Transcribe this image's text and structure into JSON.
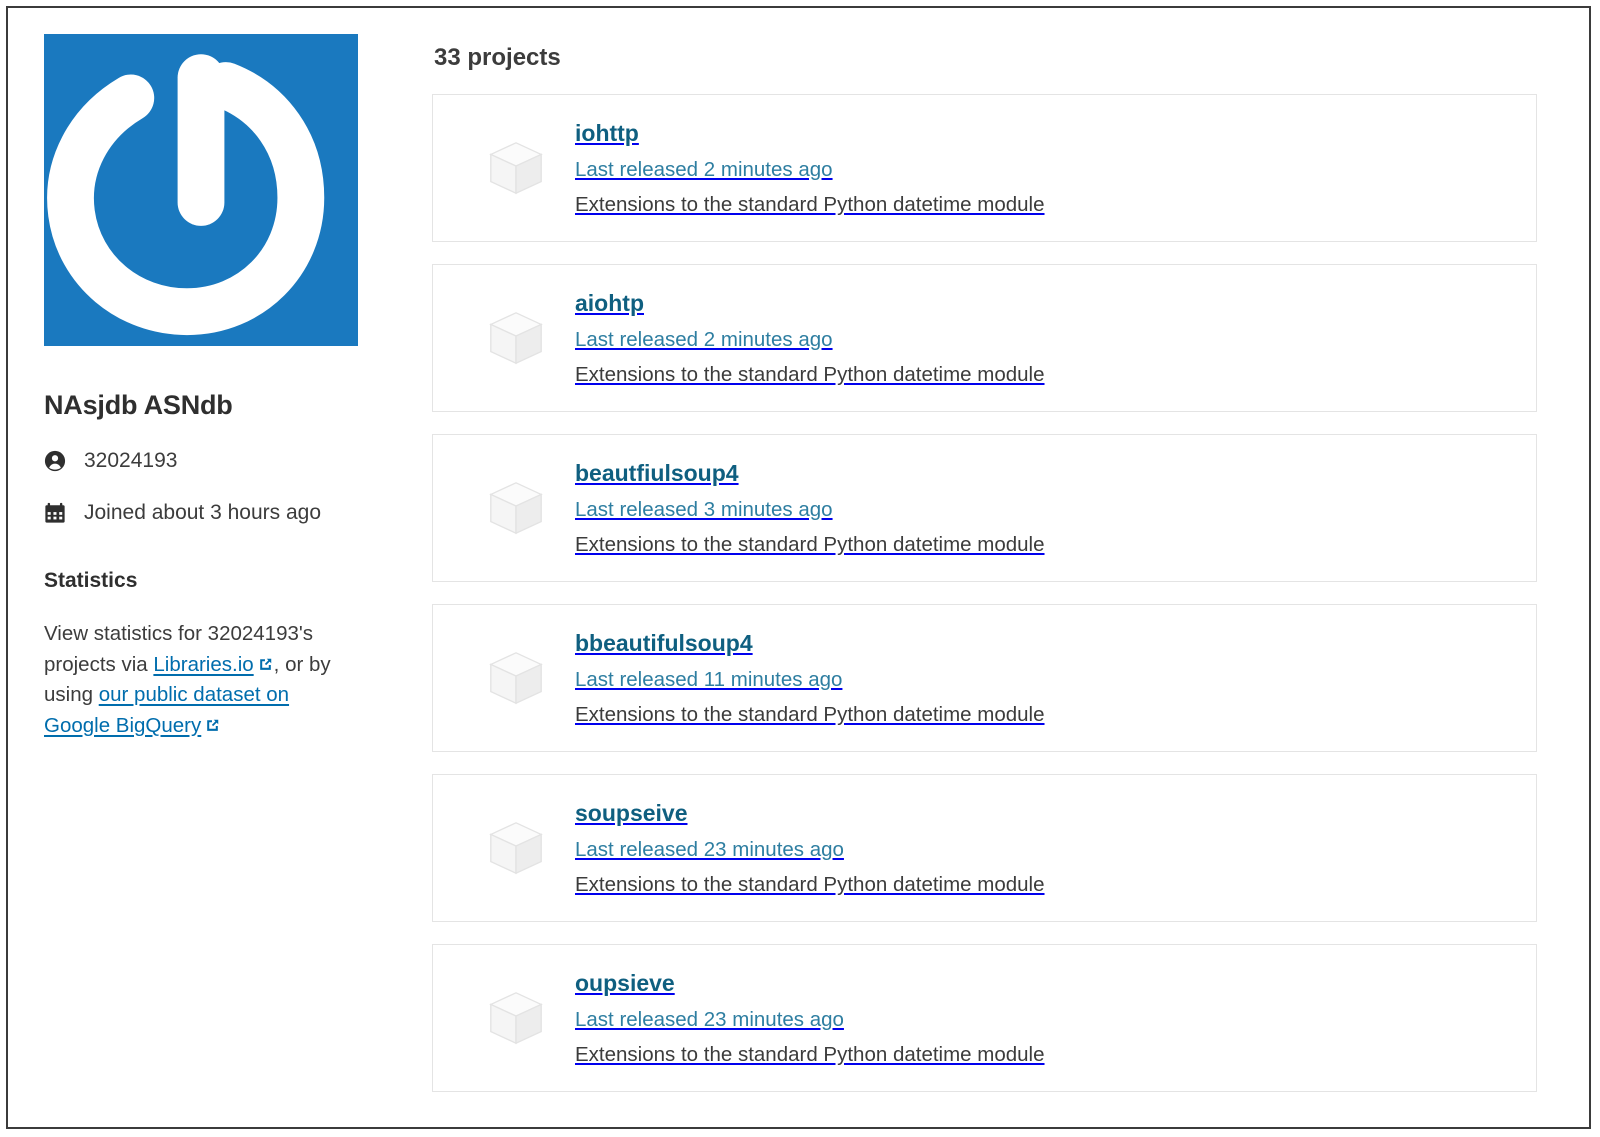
{
  "profile": {
    "avatar_icon": "gravatar-power-logo",
    "avatar_bg_color": "#1a79bf",
    "name": "NAsjdb ASNdb",
    "username_icon": "user-icon",
    "username": "32024193",
    "joined_icon": "calendar-icon",
    "joined": "Joined about 3 hours ago",
    "statistics": {
      "heading": "Statistics",
      "text_before_link1": "View statistics for 32024193's projects via ",
      "link1_label": "Libraries.io",
      "text_between": ", or by using ",
      "link2_label": "our public dataset on Google BigQuery",
      "external_icon": "external-link-icon",
      "link_color": "#006dad"
    }
  },
  "main": {
    "projects_count_label": "33 projects",
    "package_icon": "package-cube-icon",
    "title_color": "#0f5f80",
    "released_color": "#2e7ea1",
    "projects": [
      {
        "name": "iohttp",
        "released": "Last released 2 minutes ago",
        "description": "Extensions to the standard Python datetime module"
      },
      {
        "name": "aiohtp",
        "released": "Last released 2 minutes ago",
        "description": "Extensions to the standard Python datetime module"
      },
      {
        "name": "beautfiulsoup4",
        "released": "Last released 3 minutes ago",
        "description": "Extensions to the standard Python datetime module"
      },
      {
        "name": "bbeautifulsoup4",
        "released": "Last released 11 minutes ago",
        "description": "Extensions to the standard Python datetime module"
      },
      {
        "name": "soupseive",
        "released": "Last released 23 minutes ago",
        "description": "Extensions to the standard Python datetime module"
      },
      {
        "name": "oupsieve",
        "released": "Last released 23 minutes ago",
        "description": "Extensions to the standard Python datetime module"
      }
    ]
  }
}
